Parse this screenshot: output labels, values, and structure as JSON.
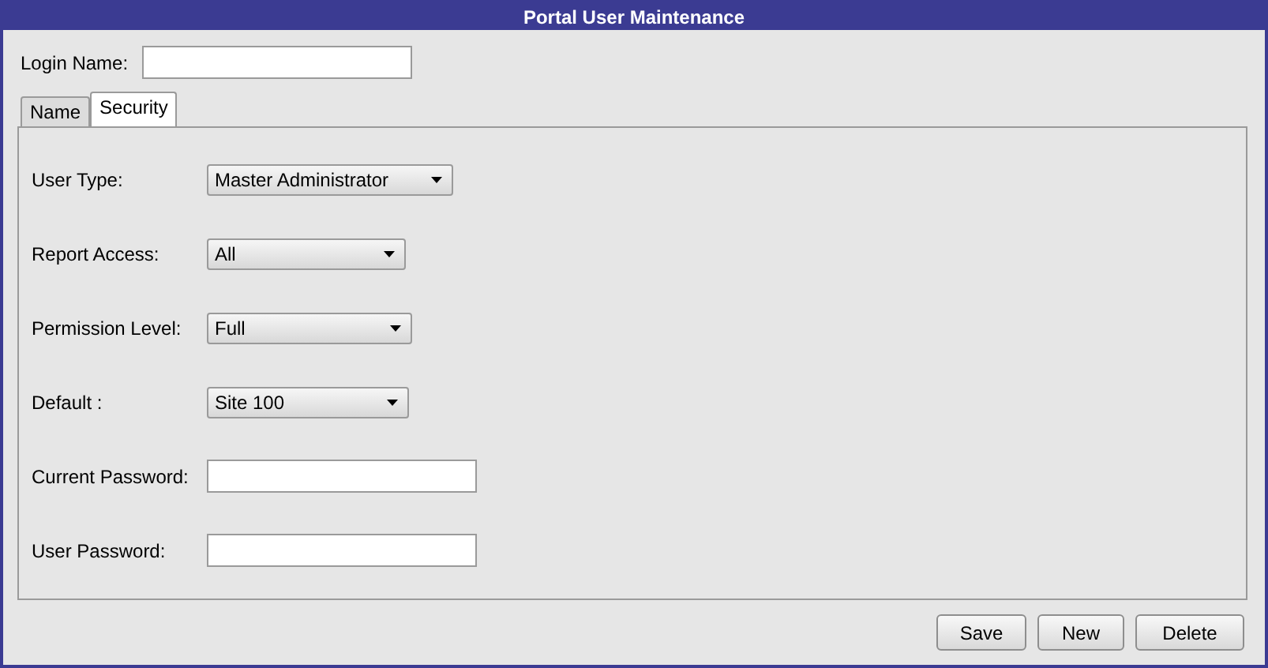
{
  "window": {
    "title": "Portal User Maintenance"
  },
  "login_name": {
    "label": "Login Name:"
  },
  "tabs": [
    {
      "label": "Name",
      "selected": false
    },
    {
      "label": "Security",
      "selected": true
    }
  ],
  "fields": [
    {
      "kind": "dropdown",
      "label": "User Type:",
      "value": "Master Administrator"
    },
    {
      "kind": "dropdown",
      "label": "Report Access:",
      "value": "All"
    },
    {
      "kind": "dropdown",
      "label": "Permission Level:",
      "value": "Full"
    },
    {
      "kind": "dropdown",
      "label": "Default :",
      "value": "Site 100"
    },
    {
      "kind": "text",
      "label": "Current Password:"
    },
    {
      "kind": "text",
      "label": "User Password:"
    }
  ],
  "buttons": [
    "Save",
    "New",
    "Delete"
  ]
}
